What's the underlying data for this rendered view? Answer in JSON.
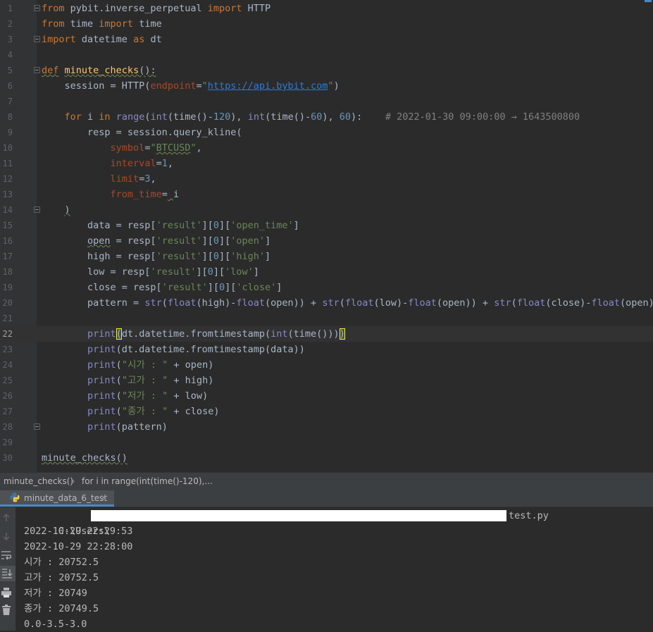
{
  "editor": {
    "lines": [
      {
        "n": "1",
        "html": "<span class=\"kw\">from</span> pybit.inverse_perpetual <span class=\"kw\">import</span> HTTP"
      },
      {
        "n": "2",
        "html": "<span class=\"kw\">from</span> time <span class=\"kw\">import</span> time"
      },
      {
        "n": "3",
        "html": "<span class=\"kw\">import</span> datetime <span class=\"kw\">as</span> dt"
      },
      {
        "n": "4",
        "html": ""
      },
      {
        "n": "5",
        "html": "<span class=\"kw sq\">def</span> <span class=\"fn sq\">minute_checks</span><span class=\"sq\">():</span>"
      },
      {
        "n": "6",
        "html": "    session = HTTP(<span class=\"param\">endpoint</span>=<span class=\"str\">\"</span><span class=\"url\">https://api.bybit.com</span><span class=\"str\">\"</span>)"
      },
      {
        "n": "7",
        "html": ""
      },
      {
        "n": "8",
        "html": "    <span class=\"kw\">for</span> i <span class=\"kw\">in</span> <span class=\"bi\">range</span>(<span class=\"bi\">int</span>(time()-<span class=\"num\">120</span>), <span class=\"bi\">int</span>(time()-<span class=\"num\">60</span>), <span class=\"num\">60</span>):    <span class=\"cm\"># 2022-01-30 09:00:00 → 1643500800</span>"
      },
      {
        "n": "9",
        "html": "        resp = session.query_kline("
      },
      {
        "n": "10",
        "html": "            <span class=\"param\">symbol</span>=<span class=\"str\">\"<span class=\"sq\">BTCUSD</span>\"</span>,"
      },
      {
        "n": "11",
        "html": "            <span class=\"param\">interval</span>=<span class=\"num\">1</span>,"
      },
      {
        "n": "12",
        "html": "            <span class=\"param\">limit</span>=<span class=\"num\">3</span>,"
      },
      {
        "n": "13",
        "html": "            <span class=\"param\">from_time</span>=<span class=\"sq\"> </span>i"
      },
      {
        "n": "14",
        "html": "    <span class=\"sq\">)</span>"
      },
      {
        "n": "15",
        "html": "        data = resp[<span class=\"str\">'result'</span>][<span class=\"num\">0</span>][<span class=\"str\">'open_time'</span>]"
      },
      {
        "n": "16",
        "html": "        <span class=\"sq\">open</span> = resp[<span class=\"str\">'result'</span>][<span class=\"num\">0</span>][<span class=\"str\">'open'</span>]"
      },
      {
        "n": "17",
        "html": "        high = resp[<span class=\"str\">'result'</span>][<span class=\"num\">0</span>][<span class=\"str\">'high'</span>]"
      },
      {
        "n": "18",
        "html": "        low = resp[<span class=\"str\">'result'</span>][<span class=\"num\">0</span>][<span class=\"str\">'low'</span>]"
      },
      {
        "n": "19",
        "html": "        close = resp[<span class=\"str\">'result'</span>][<span class=\"num\">0</span>][<span class=\"str\">'close'</span>]"
      },
      {
        "n": "20",
        "html": "        pattern = <span class=\"bi\">str</span>(<span class=\"bi\">float</span>(high)-<span class=\"bi\">float</span>(open)) + <span class=\"bi\">str</span>(<span class=\"bi\">float</span>(low)-<span class=\"bi\">float</span>(open)) + <span class=\"bi\">str</span>(<span class=\"bi\">float</span>(close)-<span class=\"bi\">float</span>(open))"
      },
      {
        "n": "21",
        "html": ""
      },
      {
        "n": "22",
        "html": "        <span class=\"bi\">print</span><span class=\"brace\">(</span>dt.datetime.fromtimestamp(<span class=\"bi\">int</span>(time()))<span class=\"brace\">)</span>"
      },
      {
        "n": "23",
        "html": "        <span class=\"bi\">print</span>(dt.datetime.fromtimestamp(data))"
      },
      {
        "n": "24",
        "html": "        <span class=\"bi\">print</span>(<span class=\"str\">\"시가 : \"</span> + open)"
      },
      {
        "n": "25",
        "html": "        <span class=\"bi\">print</span>(<span class=\"str\">\"고가 : \"</span> + high)"
      },
      {
        "n": "26",
        "html": "        <span class=\"bi\">print</span>(<span class=\"str\">\"저가 : \"</span> + low)"
      },
      {
        "n": "27",
        "html": "        <span class=\"bi\">print</span>(<span class=\"str\">\"종가 : \"</span> + close)"
      },
      {
        "n": "28",
        "html": "        <span class=\"bi\">print</span>(pattern)"
      },
      {
        "n": "29",
        "html": ""
      },
      {
        "n": "30",
        "html": "<span class=\"sq\">minute_checks()</span>"
      }
    ],
    "fold_lines": [
      1,
      3,
      5,
      14,
      28
    ],
    "current_line": 22
  },
  "breadcrumb": {
    "item1": "minute_checks()",
    "separator": "›",
    "item2": "for i in range(int(time()-120),..."
  },
  "run_panel": {
    "tab_label": "minute_data_6_test",
    "close_glyph": "×",
    "console_lines": [
      "C:\\Users\\",
      "2022-10-29 22:29:53",
      "2022-10-29 22:28:00",
      "시가 : 20752.5",
      "고가 : 20752.5",
      "저가 : 20749",
      "종가 : 20749.5",
      "0.0-3.5-3.0"
    ],
    "path_suffix": "test.py"
  },
  "toolbar_icons": [
    "up-arrow-icon",
    "down-arrow-icon",
    "soft-wrap-icon",
    "scroll-to-end-icon",
    "print-icon",
    "trash-icon"
  ]
}
